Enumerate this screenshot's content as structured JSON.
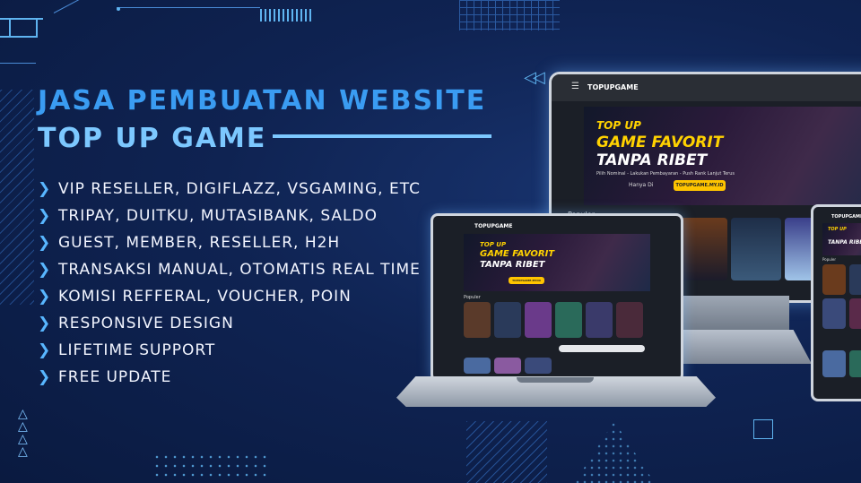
{
  "headline": {
    "line1": "JASA PEMBUATAN WEBSITE",
    "line2": "TOP UP GAME"
  },
  "features": [
    "VIP RESELLER, DIGIFLAZZ, VSGAMING, ETC",
    "TRIPAY, DUITKU, MUTASIBANK, SALDO",
    "GUEST, MEMBER, RESELLER, H2H",
    "TRANSAKSI MANUAL, OTOMATIS REAL TIME",
    "KOMISI REFFERAL, VOUCHER, POIN",
    "RESPONSIVE DESIGN",
    "LIFETIME SUPPORT",
    "FREE UPDATE"
  ],
  "mockup": {
    "brand": "TOPUPGAME",
    "banner_line1": "TOP UP",
    "banner_line2": "GAME FAVORIT",
    "banner_line3": "TANPA RIBET",
    "banner_sub": "Pilih Nominal - Lakukan Pembayaran - Push Rank Lanjut Terus",
    "banner_cta_prefix": "Hanya Di",
    "banner_cta": "TOPUPGAME.MY.ID",
    "section_label": "Populer"
  },
  "colors": {
    "accent": "#3a9cf2",
    "chevron": "#58b6ff",
    "banner_yellow": "#ffd200"
  }
}
